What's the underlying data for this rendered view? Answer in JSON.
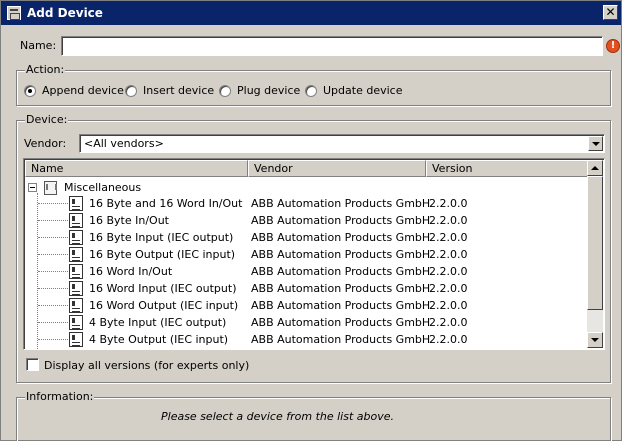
{
  "window": {
    "title": "Add Device",
    "close_glyph": "✕"
  },
  "name": {
    "label": "Name:",
    "value": "",
    "error_glyph": "!"
  },
  "action": {
    "title": "Action:",
    "options": [
      {
        "label": "Append device",
        "checked": true
      },
      {
        "label": "Insert device",
        "checked": false
      },
      {
        "label": "Plug device",
        "checked": false
      },
      {
        "label": "Update device",
        "checked": false
      }
    ]
  },
  "device": {
    "title": "Device:",
    "vendor_label": "Vendor:",
    "vendor_value": "<All vendors>",
    "columns": {
      "name": "Name",
      "vendor": "Vendor",
      "version": "Version"
    },
    "root": "Miscellaneous",
    "rows": [
      {
        "name": "16 Byte and 16 Word In/Out",
        "vendor": "ABB Automation Products GmbH",
        "version": "2.2.0.0"
      },
      {
        "name": "16 Byte In/Out",
        "vendor": "ABB Automation Products GmbH",
        "version": "2.2.0.0"
      },
      {
        "name": "16 Byte Input (IEC output)",
        "vendor": "ABB Automation Products GmbH",
        "version": "2.2.0.0"
      },
      {
        "name": "16 Byte Output (IEC input)",
        "vendor": "ABB Automation Products GmbH",
        "version": "2.2.0.0"
      },
      {
        "name": "16 Word In/Out",
        "vendor": "ABB Automation Products GmbH",
        "version": "2.2.0.0"
      },
      {
        "name": "16 Word Input (IEC output)",
        "vendor": "ABB Automation Products GmbH",
        "version": "2.2.0.0"
      },
      {
        "name": "16 Word Output (IEC input)",
        "vendor": "ABB Automation Products GmbH",
        "version": "2.2.0.0"
      },
      {
        "name": "4 Byte Input (IEC output)",
        "vendor": "ABB Automation Products GmbH",
        "version": "2.2.0.0"
      },
      {
        "name": "4 Byte Output (IEC input)",
        "vendor": "ABB Automation Products GmbH",
        "version": "2.2.0.0"
      }
    ],
    "display_all_versions": {
      "label": "Display all versions (for experts only)",
      "checked": false
    }
  },
  "information": {
    "title": "Information:",
    "message": "Please select a device from the list above."
  }
}
